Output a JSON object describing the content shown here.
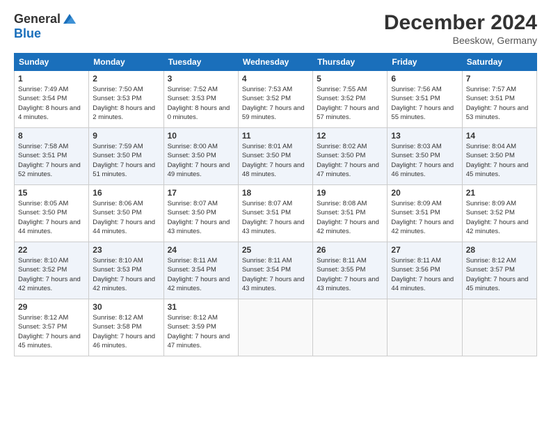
{
  "logo": {
    "general": "General",
    "blue": "Blue"
  },
  "header": {
    "month": "December 2024",
    "location": "Beeskow, Germany"
  },
  "days_of_week": [
    "Sunday",
    "Monday",
    "Tuesday",
    "Wednesday",
    "Thursday",
    "Friday",
    "Saturday"
  ],
  "weeks": [
    [
      {
        "day": "1",
        "sunrise": "7:49 AM",
        "sunset": "3:54 PM",
        "daylight": "8 hours and 4 minutes."
      },
      {
        "day": "2",
        "sunrise": "7:50 AM",
        "sunset": "3:53 PM",
        "daylight": "8 hours and 2 minutes."
      },
      {
        "day": "3",
        "sunrise": "7:52 AM",
        "sunset": "3:53 PM",
        "daylight": "8 hours and 0 minutes."
      },
      {
        "day": "4",
        "sunrise": "7:53 AM",
        "sunset": "3:52 PM",
        "daylight": "7 hours and 59 minutes."
      },
      {
        "day": "5",
        "sunrise": "7:55 AM",
        "sunset": "3:52 PM",
        "daylight": "7 hours and 57 minutes."
      },
      {
        "day": "6",
        "sunrise": "7:56 AM",
        "sunset": "3:51 PM",
        "daylight": "7 hours and 55 minutes."
      },
      {
        "day": "7",
        "sunrise": "7:57 AM",
        "sunset": "3:51 PM",
        "daylight": "7 hours and 53 minutes."
      }
    ],
    [
      {
        "day": "8",
        "sunrise": "7:58 AM",
        "sunset": "3:51 PM",
        "daylight": "7 hours and 52 minutes."
      },
      {
        "day": "9",
        "sunrise": "7:59 AM",
        "sunset": "3:50 PM",
        "daylight": "7 hours and 51 minutes."
      },
      {
        "day": "10",
        "sunrise": "8:00 AM",
        "sunset": "3:50 PM",
        "daylight": "7 hours and 49 minutes."
      },
      {
        "day": "11",
        "sunrise": "8:01 AM",
        "sunset": "3:50 PM",
        "daylight": "7 hours and 48 minutes."
      },
      {
        "day": "12",
        "sunrise": "8:02 AM",
        "sunset": "3:50 PM",
        "daylight": "7 hours and 47 minutes."
      },
      {
        "day": "13",
        "sunrise": "8:03 AM",
        "sunset": "3:50 PM",
        "daylight": "7 hours and 46 minutes."
      },
      {
        "day": "14",
        "sunrise": "8:04 AM",
        "sunset": "3:50 PM",
        "daylight": "7 hours and 45 minutes."
      }
    ],
    [
      {
        "day": "15",
        "sunrise": "8:05 AM",
        "sunset": "3:50 PM",
        "daylight": "7 hours and 44 minutes."
      },
      {
        "day": "16",
        "sunrise": "8:06 AM",
        "sunset": "3:50 PM",
        "daylight": "7 hours and 44 minutes."
      },
      {
        "day": "17",
        "sunrise": "8:07 AM",
        "sunset": "3:50 PM",
        "daylight": "7 hours and 43 minutes."
      },
      {
        "day": "18",
        "sunrise": "8:07 AM",
        "sunset": "3:51 PM",
        "daylight": "7 hours and 43 minutes."
      },
      {
        "day": "19",
        "sunrise": "8:08 AM",
        "sunset": "3:51 PM",
        "daylight": "7 hours and 42 minutes."
      },
      {
        "day": "20",
        "sunrise": "8:09 AM",
        "sunset": "3:51 PM",
        "daylight": "7 hours and 42 minutes."
      },
      {
        "day": "21",
        "sunrise": "8:09 AM",
        "sunset": "3:52 PM",
        "daylight": "7 hours and 42 minutes."
      }
    ],
    [
      {
        "day": "22",
        "sunrise": "8:10 AM",
        "sunset": "3:52 PM",
        "daylight": "7 hours and 42 minutes."
      },
      {
        "day": "23",
        "sunrise": "8:10 AM",
        "sunset": "3:53 PM",
        "daylight": "7 hours and 42 minutes."
      },
      {
        "day": "24",
        "sunrise": "8:11 AM",
        "sunset": "3:54 PM",
        "daylight": "7 hours and 42 minutes."
      },
      {
        "day": "25",
        "sunrise": "8:11 AM",
        "sunset": "3:54 PM",
        "daylight": "7 hours and 43 minutes."
      },
      {
        "day": "26",
        "sunrise": "8:11 AM",
        "sunset": "3:55 PM",
        "daylight": "7 hours and 43 minutes."
      },
      {
        "day": "27",
        "sunrise": "8:11 AM",
        "sunset": "3:56 PM",
        "daylight": "7 hours and 44 minutes."
      },
      {
        "day": "28",
        "sunrise": "8:12 AM",
        "sunset": "3:57 PM",
        "daylight": "7 hours and 45 minutes."
      }
    ],
    [
      {
        "day": "29",
        "sunrise": "8:12 AM",
        "sunset": "3:57 PM",
        "daylight": "7 hours and 45 minutes."
      },
      {
        "day": "30",
        "sunrise": "8:12 AM",
        "sunset": "3:58 PM",
        "daylight": "7 hours and 46 minutes."
      },
      {
        "day": "31",
        "sunrise": "8:12 AM",
        "sunset": "3:59 PM",
        "daylight": "7 hours and 47 minutes."
      },
      null,
      null,
      null,
      null
    ]
  ]
}
